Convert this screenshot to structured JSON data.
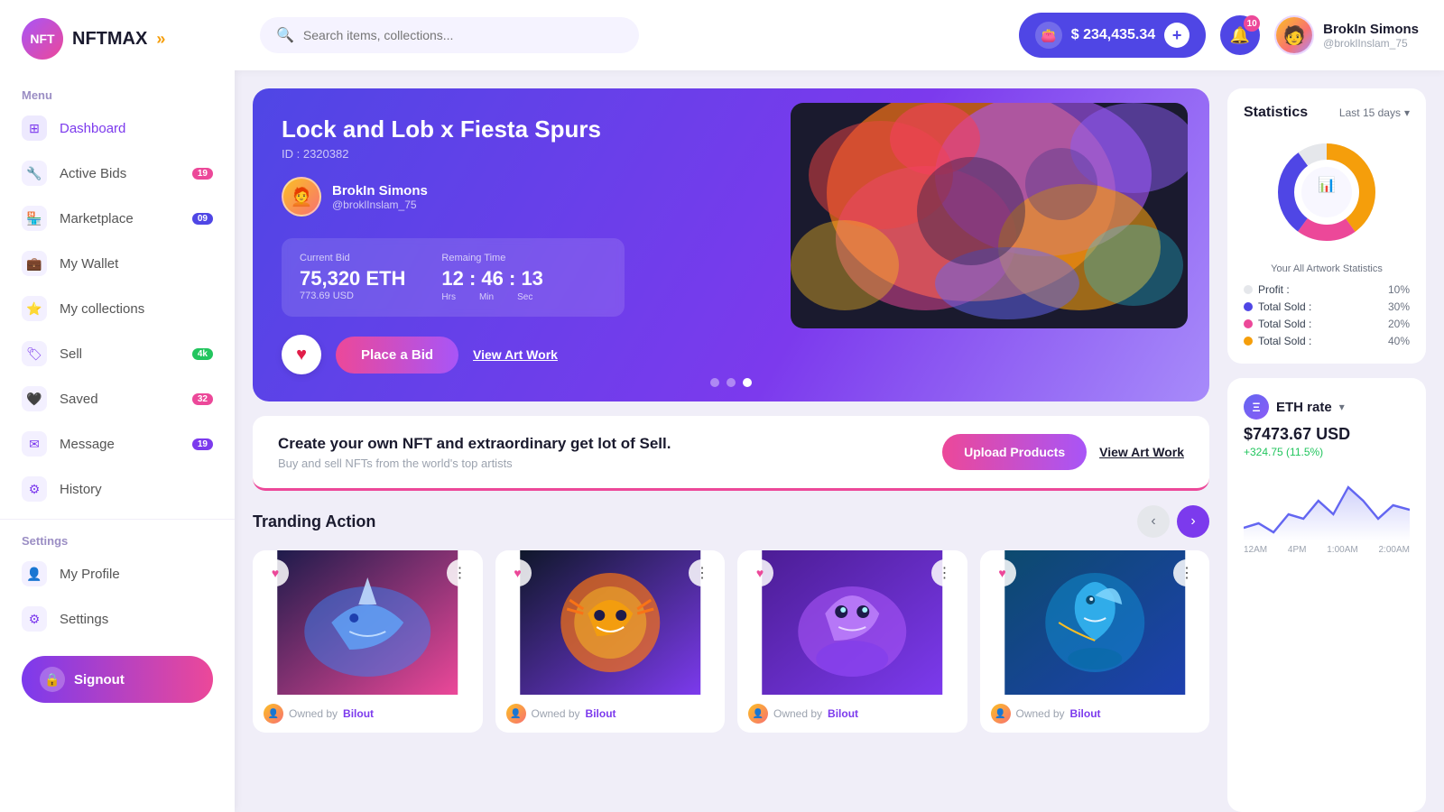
{
  "logo": {
    "short": "NFT",
    "name": "NFTMAX",
    "arrows": "»"
  },
  "menu": {
    "title": "Menu",
    "items": [
      {
        "id": "dashboard",
        "label": "Dashboard",
        "icon": "⊞",
        "active": true
      },
      {
        "id": "active-bids",
        "label": "Active Bids",
        "icon": "🔧",
        "badge": "19",
        "badge_color": "badge-pink"
      },
      {
        "id": "marketplace",
        "label": "Marketplace",
        "icon": "🏪",
        "badge": "09",
        "badge_color": "badge-blue"
      },
      {
        "id": "my-wallet",
        "label": "My Wallet",
        "icon": "💼"
      },
      {
        "id": "my-collections",
        "label": "My collections",
        "icon": "⭐"
      },
      {
        "id": "sell",
        "label": "Sell",
        "icon": "🏷",
        "badge": "4k",
        "badge_color": "badge-green"
      },
      {
        "id": "saved",
        "label": "Saved",
        "icon": "🖤",
        "badge": "32",
        "badge_color": "badge-pink"
      },
      {
        "id": "message",
        "label": "Message",
        "icon": "✉",
        "badge": "19",
        "badge_color": "badge-purple"
      },
      {
        "id": "history",
        "label": "History",
        "icon": "⚙"
      }
    ]
  },
  "settings": {
    "title": "Settings",
    "items": [
      {
        "id": "my-profile",
        "label": "My Profile",
        "icon": "👤"
      },
      {
        "id": "settings",
        "label": "Settings",
        "icon": "⚙"
      }
    ]
  },
  "signout": "Signout",
  "header": {
    "search_placeholder": "Search items, collections...",
    "wallet_amount": "$ 234,435.34",
    "notif_count": "10",
    "user_name": "BrokIn Simons",
    "user_handle": "@broklInslam_75"
  },
  "hero": {
    "title": "Lock and Lob x Fiesta Spurs",
    "id": "ID : 2320382",
    "artist_name": "BrokIn Simons",
    "artist_handle": "@broklInslam_75",
    "bid_label": "Current Bid",
    "bid_value": "75,320 ETH",
    "bid_usd": "773.69 USD",
    "time_label": "Remaing Time",
    "time_value": "12 : 46 : 13",
    "time_units": [
      "Hrs",
      "Min",
      "Sec"
    ],
    "place_bid": "Place a Bid",
    "view_artwork": "View Art Work",
    "dots": [
      false,
      false,
      true
    ]
  },
  "upload_banner": {
    "main_text": "Create your own NFT and extraordinary get lot of Sell.",
    "sub_text": "Buy and sell NFTs from the world's top artists",
    "upload_btn": "Upload Products",
    "view_link": "View Art Work"
  },
  "trending": {
    "title": "Tranding Action",
    "cards": [
      {
        "owner_prefix": "Owned by",
        "owner": "Bilout"
      },
      {
        "owner_prefix": "Owned by",
        "owner": "Bilout"
      },
      {
        "owner_prefix": "Owned by",
        "owner": "Bilout"
      },
      {
        "owner_prefix": "Owned by",
        "owner": "Bilout"
      }
    ]
  },
  "statistics": {
    "title": "Statistics",
    "filter": "Last 15 days",
    "subtitle": "Your All Artwork Statistics",
    "legend": [
      {
        "label": "Profit :",
        "value": "10%",
        "color": "#e5e7eb"
      },
      {
        "label": "Total Sold :",
        "value": "30%",
        "color": "#4f46e5"
      },
      {
        "label": "Total Sold :",
        "value": "20%",
        "color": "#ec4899"
      },
      {
        "label": "Total Sold :",
        "value": "40%",
        "color": "#f59e0b"
      }
    ],
    "donut": {
      "segments": [
        {
          "color": "#e5e7eb",
          "pct": 10
        },
        {
          "color": "#4f46e5",
          "pct": 30
        },
        {
          "color": "#ec4899",
          "pct": 20
        },
        {
          "color": "#f59e0b",
          "pct": 40
        }
      ]
    }
  },
  "eth": {
    "label": "ETH rate",
    "price": "$7473.67 USD",
    "change": "+324.75 (11.5%)",
    "x_labels": [
      "12AM",
      "4PM",
      "1:00AM",
      "2:00AM"
    ],
    "chart_points": [
      40,
      35,
      45,
      30,
      55,
      40,
      70,
      50,
      65,
      45,
      55
    ]
  }
}
